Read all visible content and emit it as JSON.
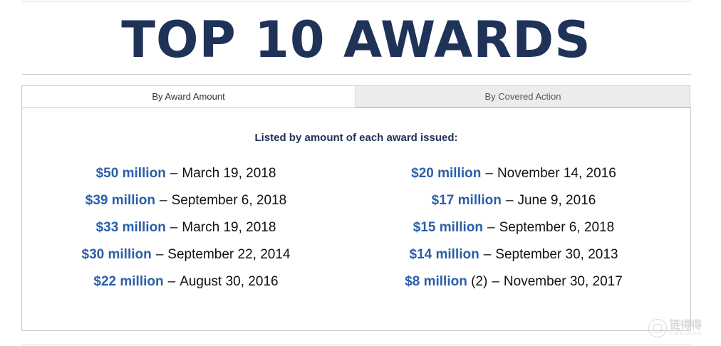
{
  "page": {
    "title": "TOP 10 AWARDS"
  },
  "tabs": [
    {
      "label": "By Award Amount",
      "active": true
    },
    {
      "label": "By Covered Action",
      "active": false
    }
  ],
  "panel": {
    "subheading": "Listed by amount of each award issued:",
    "left_column": [
      {
        "amount": "$50 million",
        "note": "",
        "date": "March 19, 2018"
      },
      {
        "amount": "$39 million",
        "note": "",
        "date": "September 6, 2018"
      },
      {
        "amount": "$33 million",
        "note": "",
        "date": "March 19, 2018"
      },
      {
        "amount": "$30 million",
        "note": "",
        "date": "September 22, 2014"
      },
      {
        "amount": "$22 million",
        "note": "",
        "date": "August 30, 2016"
      }
    ],
    "right_column": [
      {
        "amount": "$20 million",
        "note": "",
        "date": "November 14, 2016"
      },
      {
        "amount": "$17 million",
        "note": "",
        "date": "June 9, 2016"
      },
      {
        "amount": "$15 million",
        "note": "",
        "date": "September 6, 2018"
      },
      {
        "amount": "$14 million",
        "note": "",
        "date": "September 30, 2013"
      },
      {
        "amount": "$8 million",
        "note": "(2)",
        "date": "November 30, 2017"
      }
    ],
    "separator": "–"
  },
  "watermark": {
    "name": "链得得",
    "sub": "CHAINDD",
    "icon": "chaindd-logo-icon"
  },
  "colors": {
    "title": "#1f3358",
    "amount": "#2a5fa8",
    "inactive_tab": "#ececec"
  }
}
